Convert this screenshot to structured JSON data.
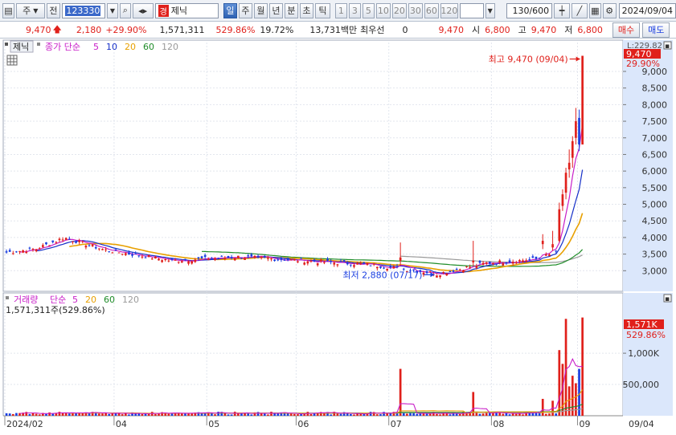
{
  "toolbar": {
    "market": "주",
    "type": "전",
    "code": "123330",
    "name": "제닉",
    "warning_badge": "경",
    "periods": [
      "일",
      "주",
      "월",
      "년",
      "분",
      "초",
      "틱"
    ],
    "active_period": "일",
    "minutes": [
      "1",
      "3",
      "5",
      "10",
      "20",
      "30",
      "60",
      "120"
    ],
    "count": "130",
    "max_count": "/600",
    "date": "2024/09/04"
  },
  "quote": {
    "price": "9,470",
    "change": "2,180",
    "change_pct": "+29.90%",
    "volume": "1,571,311",
    "volume_ratio": "529.86%",
    "turnover": "19.72%",
    "amount": "13,731백만",
    "preferred_label": "최우선",
    "preferred_value": "0",
    "ask": "9,470",
    "open_label": "시",
    "open": "6,800",
    "high_label": "고",
    "high": "9,470",
    "low_label": "저",
    "low": "6,800",
    "buy_label": "매수",
    "sell_label": "매도"
  },
  "colors": {
    "up": "#e0201b",
    "down": "#1a3ee0",
    "ma5": "#c81ec8",
    "ma10": "#1630c8",
    "ma20": "#e8a000",
    "ma60": "#1e8c28",
    "ma120": "#9a9a9a"
  },
  "price_panel": {
    "tab": "제닉",
    "legend_prefix": "종가 단순",
    "ma_periods": [
      "5",
      "10",
      "20",
      "60",
      "120"
    ],
    "top_label": "L:229.82",
    "current_badge": "9,470",
    "current_pct": "29.90%",
    "high_annotation": "최고 9,470 (09/04)",
    "low_annotation": "최저 2,880 (07/17)"
  },
  "volume_panel": {
    "legend_prefix": "거래량",
    "legend_mode": "단순",
    "ma_periods": [
      "5",
      "20",
      "60",
      "120"
    ],
    "info": "1,571,311주(529.86%)",
    "current_badge": "1,571K",
    "current_pct": "529.86%"
  },
  "chart_data": {
    "type": "candlestick",
    "price_axis": {
      "ticks": [
        3000,
        3500,
        4000,
        4500,
        5000,
        5500,
        6000,
        6500,
        7000,
        7500,
        8000,
        8500,
        9000
      ],
      "tick_labels": [
        "3,000",
        "3,500",
        "4,000",
        "4,500",
        "5,000",
        "5,500",
        "6,000",
        "6,500",
        "7,000",
        "7,500",
        "8,000",
        "8,500",
        "9,000"
      ],
      "range": [
        2500,
        9700
      ]
    },
    "volume_axis": {
      "ticks": [
        500000,
        1000000
      ],
      "tick_labels": [
        "500,000",
        "1,000K"
      ],
      "range": [
        0,
        1900000
      ]
    },
    "x_labels": [
      "2024/02",
      "04",
      "05",
      "06",
      "07",
      "08",
      "09",
      "09/04"
    ],
    "x_label_index": [
      0,
      33,
      61,
      88,
      116,
      147,
      173,
      185
    ],
    "events": {
      "low_index": 130,
      "low_value": 2880,
      "high_index": 176,
      "high_value": 9470
    },
    "spikes": [
      {
        "i": 119,
        "o": 3300,
        "h": 3850,
        "l": 3150,
        "c": 3400,
        "v": 750000
      },
      {
        "i": 141,
        "o": 3250,
        "h": 3900,
        "l": 3150,
        "c": 3300,
        "v": 380000
      },
      {
        "i": 162,
        "o": 3800,
        "h": 4100,
        "l": 3650,
        "c": 3900,
        "v": 270000
      },
      {
        "i": 165,
        "o": 3700,
        "h": 4200,
        "l": 3600,
        "c": 3800,
        "v": 240000
      },
      {
        "i": 167,
        "o": 3900,
        "h": 5050,
        "l": 3850,
        "c": 4850,
        "v": 1050000
      },
      {
        "i": 168,
        "o": 4950,
        "h": 5450,
        "l": 4800,
        "c": 5300,
        "v": 830000
      },
      {
        "i": 169,
        "o": 5350,
        "h": 6100,
        "l": 5150,
        "c": 5950,
        "v": 1550000
      },
      {
        "i": 170,
        "o": 6050,
        "h": 6650,
        "l": 5800,
        "c": 6250,
        "v": 470000
      },
      {
        "i": 171,
        "o": 6400,
        "h": 7050,
        "l": 6100,
        "c": 6900,
        "v": 640000
      },
      {
        "i": 172,
        "o": 7000,
        "h": 7900,
        "l": 6800,
        "c": 7500,
        "v": 520000
      },
      {
        "i": 173,
        "o": 7600,
        "h": 7850,
        "l": 6600,
        "c": 6800,
        "v": 750000
      },
      {
        "i": 174,
        "o": 6800,
        "h": 9470,
        "l": 6800,
        "c": 9470,
        "v": 1571311
      }
    ]
  }
}
